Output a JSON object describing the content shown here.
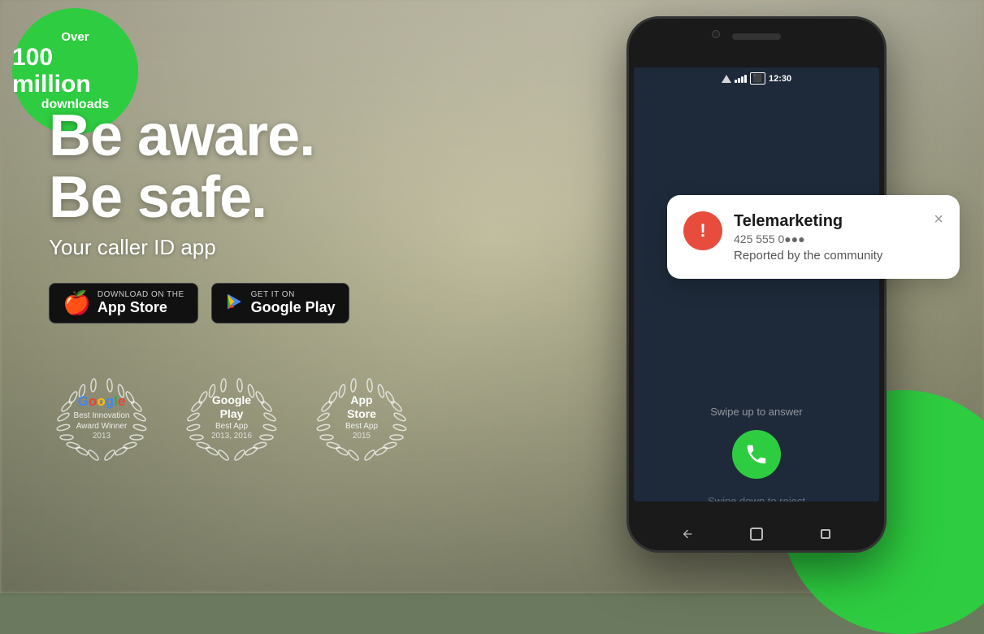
{
  "badge": {
    "over": "Over",
    "million": "100 million",
    "downloads": "downloads"
  },
  "headline": {
    "line1": "Be aware.",
    "line2": "Be safe.",
    "subheadline": "Your caller ID app"
  },
  "app_store": {
    "label_top": "Download on the",
    "label_bottom": "App Store",
    "icon": "🍎"
  },
  "google_play": {
    "label_top": "GET IT ON",
    "label_bottom": "Google Play",
    "icon": "▶"
  },
  "awards": [
    {
      "brand": "Google",
      "sub": "Best Innovation\nAward Winner",
      "year": "2013"
    },
    {
      "brand": "Google\nPlay",
      "sub": "Best App",
      "year": "2013, 2016"
    },
    {
      "brand": "App\nStore",
      "sub": "Best App",
      "year": "2015"
    }
  ],
  "notification": {
    "title": "Telemarketing",
    "number": "425 555 0●●●",
    "description": "Reported by the community",
    "close_label": "×"
  },
  "phone": {
    "time": "12:30",
    "swipe_up": "Swipe up to answer",
    "swipe_down": "Swipe down to reject"
  },
  "colors": {
    "green": "#2ecc40",
    "dark": "#1a1a1a",
    "phone_bg": "#1e2a3a",
    "accent_red": "#e74c3c"
  }
}
